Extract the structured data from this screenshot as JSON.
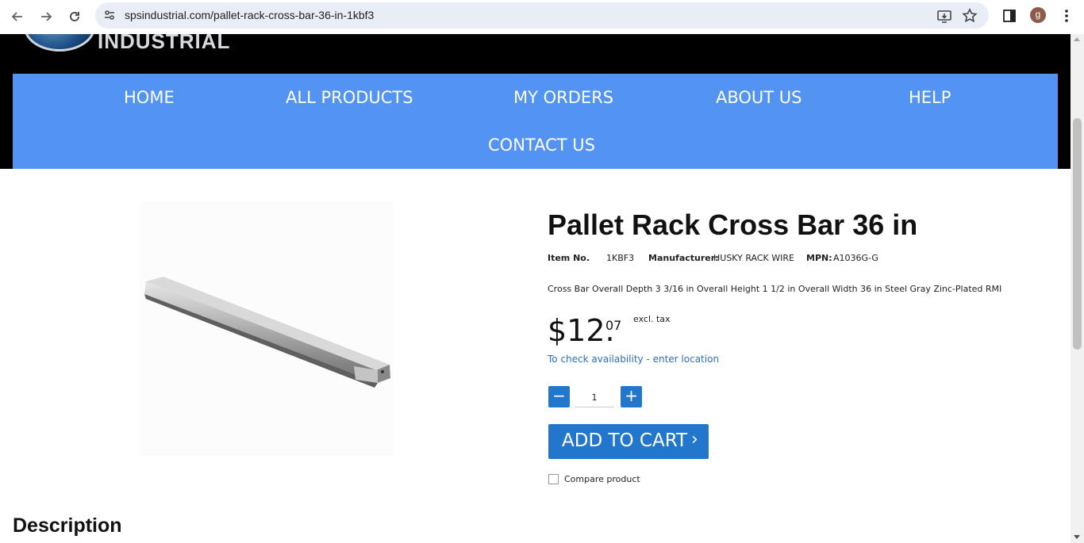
{
  "browser": {
    "url": "spsindustrial.com/pallet-rack-cross-bar-36-in-1kbf3",
    "avatar_letter": "g"
  },
  "site": {
    "logo_text": "INDUSTRIAL",
    "menu": [
      {
        "label": "HOME"
      },
      {
        "label": "ALL PRODUCTS"
      },
      {
        "label": "MY ORDERS"
      },
      {
        "label": "ABOUT US"
      },
      {
        "label": "HELP"
      },
      {
        "label": "CONTACT US"
      }
    ],
    "accent_color": "#5394f3",
    "button_color": "#2277cc"
  },
  "product": {
    "title": "Pallet Rack Cross Bar 36 in",
    "item_no_label": "Item No.",
    "item_no": "1KBF3",
    "manufacturer_label": "Manufacturer:",
    "manufacturer": "HUSKY RACK WIRE",
    "mpn_label": "MPN:",
    "mpn": "A1036G-G",
    "short_description": "Cross Bar Overall Depth 3 3/16 in Overall Height 1 1/2 in Overall Width 36 in Steel Gray Zinc-Plated RMI",
    "price_main": "$12.",
    "price_cents": "07",
    "price_tax": "excl. tax",
    "availability_link": "To check availability - enter location",
    "quantity": "1",
    "minus_label": "−",
    "plus_label": "+",
    "add_to_cart": "ADD TO CART",
    "add_to_cart_arrow": "›",
    "compare_label": "Compare product"
  },
  "description": {
    "title": "Description"
  }
}
